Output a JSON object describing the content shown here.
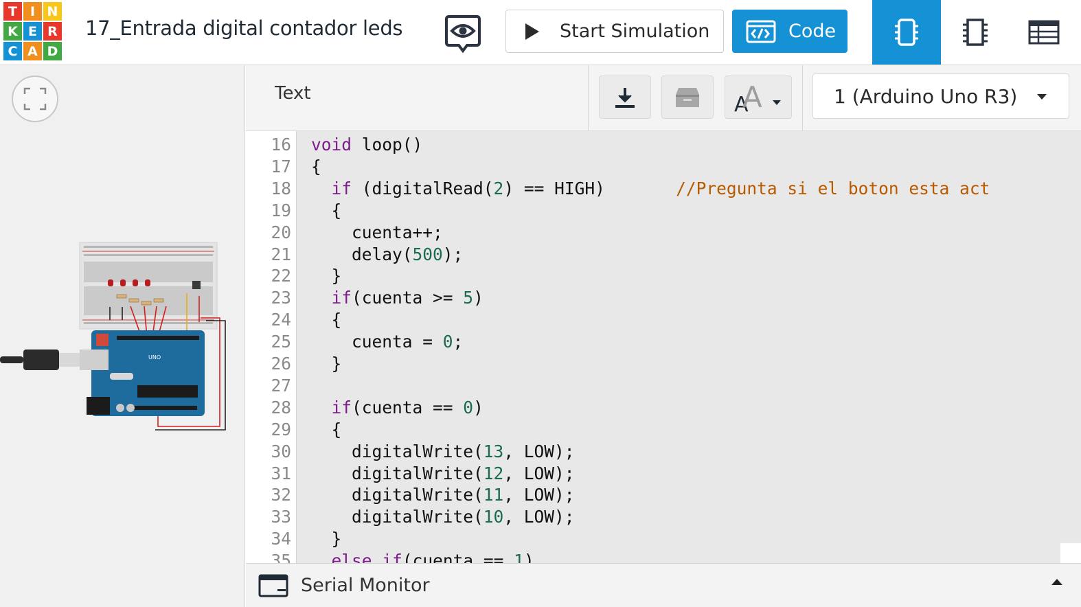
{
  "logo": {
    "letters": [
      "T",
      "I",
      "N",
      "K",
      "E",
      "R",
      "C",
      "A",
      "D"
    ],
    "colors": [
      "#e8372b",
      "#f08f1d",
      "#f7c81b",
      "#42a843",
      "#1592d5",
      "#e8372b",
      "#1592d5",
      "#f08f1d",
      "#42a843"
    ]
  },
  "header": {
    "project_title": "17_Entrada digital contador leds",
    "start_simulation": "Start Simulation",
    "code_button": "Code"
  },
  "panel": {
    "mode": "Text",
    "device": "1 (Arduino Uno R3)"
  },
  "code_lines": [
    {
      "n": "16",
      "text": "void loop()"
    },
    {
      "n": "17",
      "text": "{"
    },
    {
      "n": "18",
      "text": "  if (digitalRead(2) == HIGH)       //Pregunta si el boton esta act"
    },
    {
      "n": "19",
      "text": "  {"
    },
    {
      "n": "20",
      "text": "    cuenta++;"
    },
    {
      "n": "21",
      "text": "    delay(500);"
    },
    {
      "n": "22",
      "text": "  }"
    },
    {
      "n": "23",
      "text": "  if(cuenta >= 5)"
    },
    {
      "n": "24",
      "text": "  {"
    },
    {
      "n": "25",
      "text": "    cuenta = 0;"
    },
    {
      "n": "26",
      "text": "  }"
    },
    {
      "n": "27",
      "text": ""
    },
    {
      "n": "28",
      "text": "  if(cuenta == 0)"
    },
    {
      "n": "29",
      "text": "  {"
    },
    {
      "n": "30",
      "text": "    digitalWrite(13, LOW);"
    },
    {
      "n": "31",
      "text": "    digitalWrite(12, LOW);"
    },
    {
      "n": "32",
      "text": "    digitalWrite(11, LOW);"
    },
    {
      "n": "33",
      "text": "    digitalWrite(10, LOW);"
    },
    {
      "n": "34",
      "text": "  }"
    },
    {
      "n": "35",
      "text": "  else if(cuenta == 1)"
    }
  ],
  "serial_monitor": {
    "label": "Serial Monitor"
  },
  "colors": {
    "accent": "#1592d5",
    "keyword": "#7b1d8a",
    "number": "#1b6b4e",
    "comment": "#b85a00"
  },
  "icons": {
    "eye": "eye-icon",
    "play": "play-icon",
    "code": "code-icon",
    "schematic": "breadboard-icon",
    "component": "chip-icon",
    "components_list": "list-icon",
    "download": "download-icon",
    "library": "archive-icon",
    "font_size": "font-size-icon",
    "fit": "fit-view-icon",
    "serial": "terminal-icon"
  }
}
